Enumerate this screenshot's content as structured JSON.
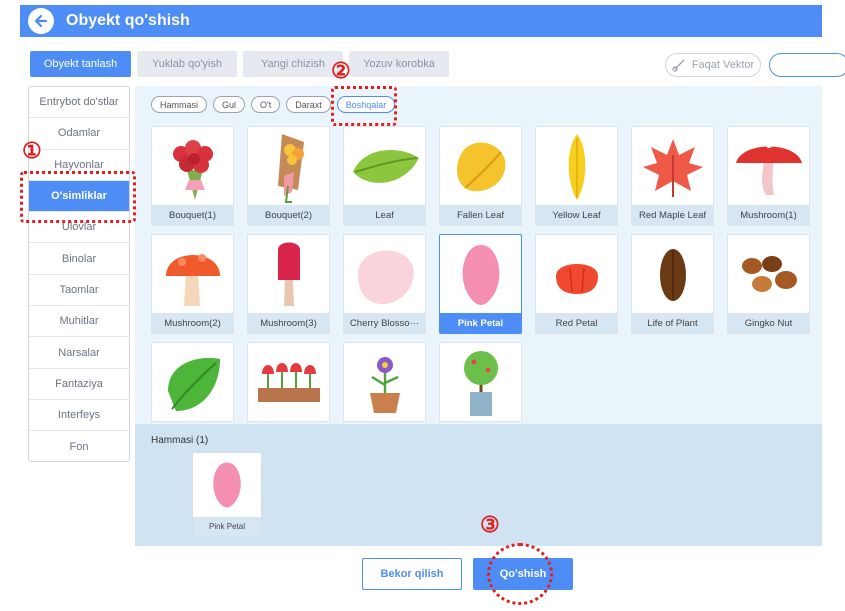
{
  "title": "Obyekt qo'shish",
  "tabs": [
    "Obyekt tanlash",
    "Yuklab qo'yish",
    "Yangi chizish",
    "Yozuv korobka"
  ],
  "vector_label": "Faqat Vektor",
  "sidebar": [
    "Entrybot do'stlar",
    "Odamlar",
    "Hayvonlar",
    "O'simliklar",
    "Ulovlar",
    "Binolar",
    "Taomlar",
    "Muhitlar",
    "Narsalar",
    "Fantaziya",
    "Interfeys",
    "Fon"
  ],
  "filters": [
    "Hammasi",
    "Gul",
    "O't",
    "Daraxt",
    "Boshqalar"
  ],
  "items": [
    {
      "label": "Bouquet(1)",
      "icon": "bouquet-red"
    },
    {
      "label": "Bouquet(2)",
      "icon": "bouquet-yellow"
    },
    {
      "label": "Leaf",
      "icon": "leaf"
    },
    {
      "label": "Fallen Leaf",
      "icon": "fallen-leaf"
    },
    {
      "label": "Yellow Leaf",
      "icon": "yellow-leaf"
    },
    {
      "label": "Red Maple Leaf",
      "icon": "maple-leaf"
    },
    {
      "label": "Mushroom(1)",
      "icon": "mushroom-red"
    },
    {
      "label": "Mushroom(2)",
      "icon": "mushroom-orange"
    },
    {
      "label": "Mushroom(3)",
      "icon": "mushroom-pink"
    },
    {
      "label": "Cherry Blosso···",
      "icon": "cherry-petal"
    },
    {
      "label": "Pink Petal",
      "icon": "pink-petal"
    },
    {
      "label": "Red Petal",
      "icon": "red-petal"
    },
    {
      "label": "Life of Plant",
      "icon": "seed"
    },
    {
      "label": "Gingko Nut",
      "icon": "gingko-nut"
    },
    {
      "label": "",
      "icon": "green-leaf"
    },
    {
      "label": "",
      "icon": "tulip-planter"
    },
    {
      "label": "",
      "icon": "potted-flower"
    },
    {
      "label": "",
      "icon": "potted-tree"
    }
  ],
  "selected_title": "Hammasi (1)",
  "selected_items": [
    {
      "label": "Pink Petal",
      "icon": "pink-petal"
    }
  ],
  "buttons": {
    "cancel": "Bekor qilish",
    "add": "Qo'shish"
  },
  "markers": [
    "①",
    "②",
    "③"
  ],
  "colors": {
    "accent": "#4d8df5",
    "highlight": "#e02020"
  }
}
